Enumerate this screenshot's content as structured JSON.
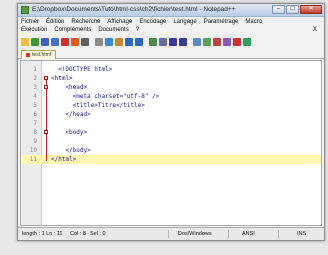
{
  "window": {
    "title": "E:\\Dropbox\\Documents\\Tuto\\html-css\\ch2\\fichier\\test.html - Notepad++",
    "buttons": [
      "–",
      "□",
      "✕"
    ]
  },
  "menu": {
    "row1": [
      "Fichier",
      "Édition",
      "Recherche",
      "Affichage",
      "Encodage",
      "Langage",
      "Paramétrage",
      "Macro"
    ],
    "row2": [
      "Exécution",
      "Compléments",
      "Documents",
      "?"
    ],
    "row2_end": "X"
  },
  "toolbar": {
    "icons": [
      {
        "name": "new-file-icon",
        "color": "#f0c040"
      },
      {
        "name": "open-file-icon",
        "color": "#3f9a3a"
      },
      {
        "name": "save-icon",
        "color": "#4060c0"
      },
      {
        "name": "save-all-icon",
        "color": "#4a70c8"
      },
      {
        "name": "close-icon",
        "color": "#d03030"
      },
      {
        "name": "close-all-icon",
        "color": "#e05a20"
      },
      {
        "name": "print-icon",
        "color": "#606060"
      },
      {
        "name": "cut-icon",
        "color": "#8a8a8a"
      },
      {
        "name": "copy-icon",
        "color": "#3a8ad0"
      },
      {
        "name": "paste-icon",
        "color": "#c08a30"
      },
      {
        "name": "undo-icon",
        "color": "#2a6ac0"
      },
      {
        "name": "redo-icon",
        "color": "#2a6ac0"
      },
      {
        "name": "find-icon",
        "color": "#4a8a4a"
      },
      {
        "name": "replace-icon",
        "color": "#6a6aa0"
      },
      {
        "name": "zoom-in-icon",
        "color": "#3a3a9a"
      },
      {
        "name": "zoom-out-icon",
        "color": "#3a3a9a"
      },
      {
        "name": "sync-scroll-icon",
        "color": "#5a8abf"
      },
      {
        "name": "word-wrap-icon",
        "color": "#5aa05a"
      },
      {
        "name": "show-all-icon",
        "color": "#c04040"
      },
      {
        "name": "indent-guide-icon",
        "color": "#8a5ab0"
      },
      {
        "name": "record-macro-icon",
        "color": "#d03030"
      },
      {
        "name": "play-macro-icon",
        "color": "#30a060"
      }
    ]
  },
  "tab": {
    "label": "test.html"
  },
  "editor": {
    "lines": [
      {
        "n": "1",
        "indent": 2,
        "text": "<!DOCTYPE html>"
      },
      {
        "n": "2",
        "indent": 0,
        "text": "<html>"
      },
      {
        "n": "3",
        "indent": 4,
        "text": "<head>"
      },
      {
        "n": "4",
        "indent": 6,
        "text": "<meta charset=\"utf-8\" />"
      },
      {
        "n": "5",
        "indent": 6,
        "text": "<title>Titre</title>"
      },
      {
        "n": "6",
        "indent": 4,
        "text": "</head>"
      },
      {
        "n": "7",
        "indent": 0,
        "text": ""
      },
      {
        "n": "8",
        "indent": 4,
        "text": "<body>"
      },
      {
        "n": "9",
        "indent": 0,
        "text": ""
      },
      {
        "n": "10",
        "indent": 4,
        "text": "</body>"
      },
      {
        "n": "11",
        "indent": 0,
        "text": "</html>"
      }
    ],
    "current_line": 11
  },
  "status": {
    "length": "length : 1 Ln : 11",
    "col": "Col : 8",
    "sel": "Sel : 0",
    "eol": "Dos\\Windows",
    "encoding": "ANSI",
    "mode": "INS"
  }
}
